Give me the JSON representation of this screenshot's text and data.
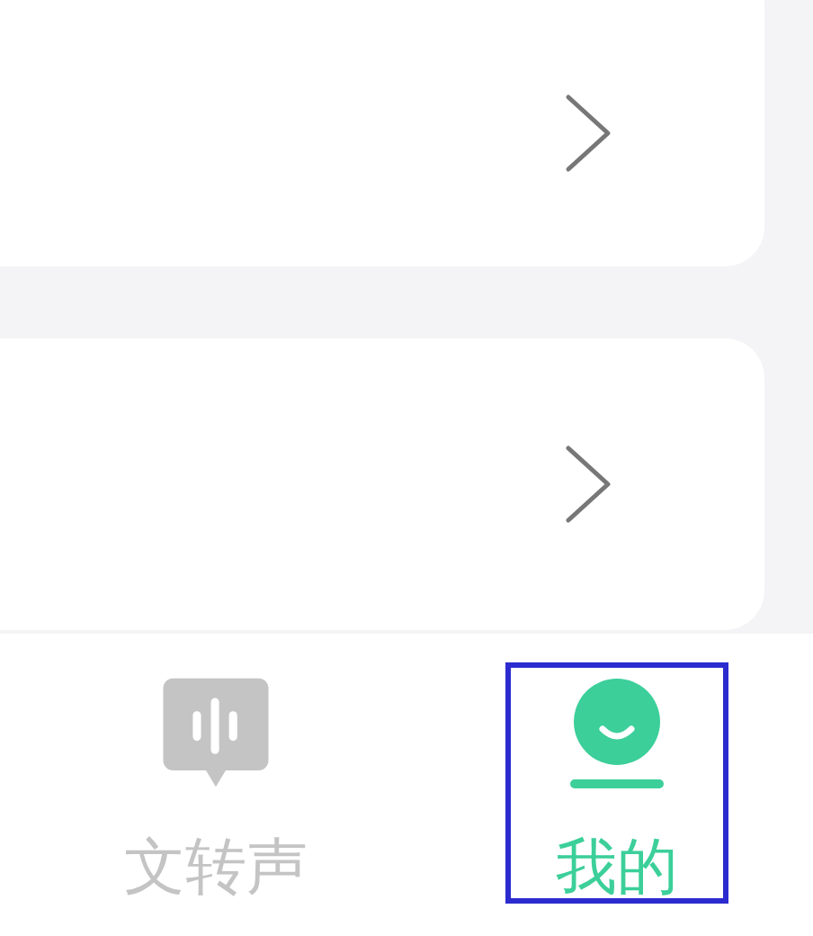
{
  "cards": [
    {
      "kind": "link"
    },
    {
      "kind": "link"
    }
  ],
  "nav": [
    {
      "label": "文转声",
      "kind": "voice",
      "selected": false,
      "annotated": false
    },
    {
      "label": "我的",
      "kind": "profile",
      "selected": true,
      "annotated": true
    }
  ]
}
